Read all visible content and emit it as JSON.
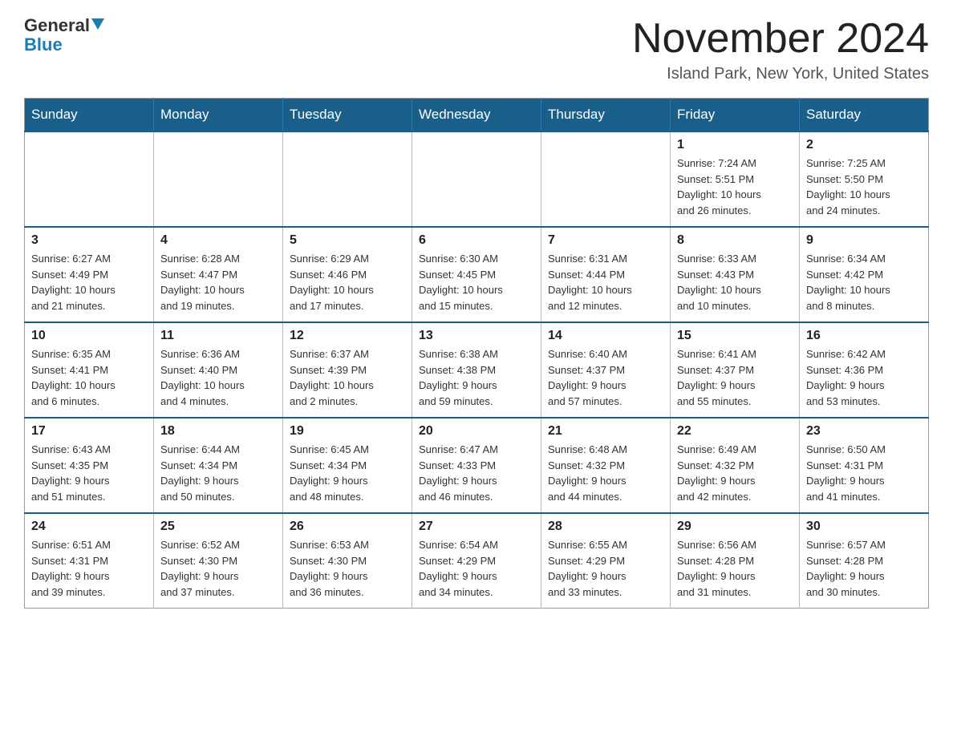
{
  "header": {
    "logo_line1": "General",
    "logo_line2": "Blue",
    "title": "November 2024",
    "subtitle": "Island Park, New York, United States"
  },
  "weekdays": [
    "Sunday",
    "Monday",
    "Tuesday",
    "Wednesday",
    "Thursday",
    "Friday",
    "Saturday"
  ],
  "weeks": [
    [
      {
        "day": "",
        "info": ""
      },
      {
        "day": "",
        "info": ""
      },
      {
        "day": "",
        "info": ""
      },
      {
        "day": "",
        "info": ""
      },
      {
        "day": "",
        "info": ""
      },
      {
        "day": "1",
        "info": "Sunrise: 7:24 AM\nSunset: 5:51 PM\nDaylight: 10 hours\nand 26 minutes."
      },
      {
        "day": "2",
        "info": "Sunrise: 7:25 AM\nSunset: 5:50 PM\nDaylight: 10 hours\nand 24 minutes."
      }
    ],
    [
      {
        "day": "3",
        "info": "Sunrise: 6:27 AM\nSunset: 4:49 PM\nDaylight: 10 hours\nand 21 minutes."
      },
      {
        "day": "4",
        "info": "Sunrise: 6:28 AM\nSunset: 4:47 PM\nDaylight: 10 hours\nand 19 minutes."
      },
      {
        "day": "5",
        "info": "Sunrise: 6:29 AM\nSunset: 4:46 PM\nDaylight: 10 hours\nand 17 minutes."
      },
      {
        "day": "6",
        "info": "Sunrise: 6:30 AM\nSunset: 4:45 PM\nDaylight: 10 hours\nand 15 minutes."
      },
      {
        "day": "7",
        "info": "Sunrise: 6:31 AM\nSunset: 4:44 PM\nDaylight: 10 hours\nand 12 minutes."
      },
      {
        "day": "8",
        "info": "Sunrise: 6:33 AM\nSunset: 4:43 PM\nDaylight: 10 hours\nand 10 minutes."
      },
      {
        "day": "9",
        "info": "Sunrise: 6:34 AM\nSunset: 4:42 PM\nDaylight: 10 hours\nand 8 minutes."
      }
    ],
    [
      {
        "day": "10",
        "info": "Sunrise: 6:35 AM\nSunset: 4:41 PM\nDaylight: 10 hours\nand 6 minutes."
      },
      {
        "day": "11",
        "info": "Sunrise: 6:36 AM\nSunset: 4:40 PM\nDaylight: 10 hours\nand 4 minutes."
      },
      {
        "day": "12",
        "info": "Sunrise: 6:37 AM\nSunset: 4:39 PM\nDaylight: 10 hours\nand 2 minutes."
      },
      {
        "day": "13",
        "info": "Sunrise: 6:38 AM\nSunset: 4:38 PM\nDaylight: 9 hours\nand 59 minutes."
      },
      {
        "day": "14",
        "info": "Sunrise: 6:40 AM\nSunset: 4:37 PM\nDaylight: 9 hours\nand 57 minutes."
      },
      {
        "day": "15",
        "info": "Sunrise: 6:41 AM\nSunset: 4:37 PM\nDaylight: 9 hours\nand 55 minutes."
      },
      {
        "day": "16",
        "info": "Sunrise: 6:42 AM\nSunset: 4:36 PM\nDaylight: 9 hours\nand 53 minutes."
      }
    ],
    [
      {
        "day": "17",
        "info": "Sunrise: 6:43 AM\nSunset: 4:35 PM\nDaylight: 9 hours\nand 51 minutes."
      },
      {
        "day": "18",
        "info": "Sunrise: 6:44 AM\nSunset: 4:34 PM\nDaylight: 9 hours\nand 50 minutes."
      },
      {
        "day": "19",
        "info": "Sunrise: 6:45 AM\nSunset: 4:34 PM\nDaylight: 9 hours\nand 48 minutes."
      },
      {
        "day": "20",
        "info": "Sunrise: 6:47 AM\nSunset: 4:33 PM\nDaylight: 9 hours\nand 46 minutes."
      },
      {
        "day": "21",
        "info": "Sunrise: 6:48 AM\nSunset: 4:32 PM\nDaylight: 9 hours\nand 44 minutes."
      },
      {
        "day": "22",
        "info": "Sunrise: 6:49 AM\nSunset: 4:32 PM\nDaylight: 9 hours\nand 42 minutes."
      },
      {
        "day": "23",
        "info": "Sunrise: 6:50 AM\nSunset: 4:31 PM\nDaylight: 9 hours\nand 41 minutes."
      }
    ],
    [
      {
        "day": "24",
        "info": "Sunrise: 6:51 AM\nSunset: 4:31 PM\nDaylight: 9 hours\nand 39 minutes."
      },
      {
        "day": "25",
        "info": "Sunrise: 6:52 AM\nSunset: 4:30 PM\nDaylight: 9 hours\nand 37 minutes."
      },
      {
        "day": "26",
        "info": "Sunrise: 6:53 AM\nSunset: 4:30 PM\nDaylight: 9 hours\nand 36 minutes."
      },
      {
        "day": "27",
        "info": "Sunrise: 6:54 AM\nSunset: 4:29 PM\nDaylight: 9 hours\nand 34 minutes."
      },
      {
        "day": "28",
        "info": "Sunrise: 6:55 AM\nSunset: 4:29 PM\nDaylight: 9 hours\nand 33 minutes."
      },
      {
        "day": "29",
        "info": "Sunrise: 6:56 AM\nSunset: 4:28 PM\nDaylight: 9 hours\nand 31 minutes."
      },
      {
        "day": "30",
        "info": "Sunrise: 6:57 AM\nSunset: 4:28 PM\nDaylight: 9 hours\nand 30 minutes."
      }
    ]
  ]
}
